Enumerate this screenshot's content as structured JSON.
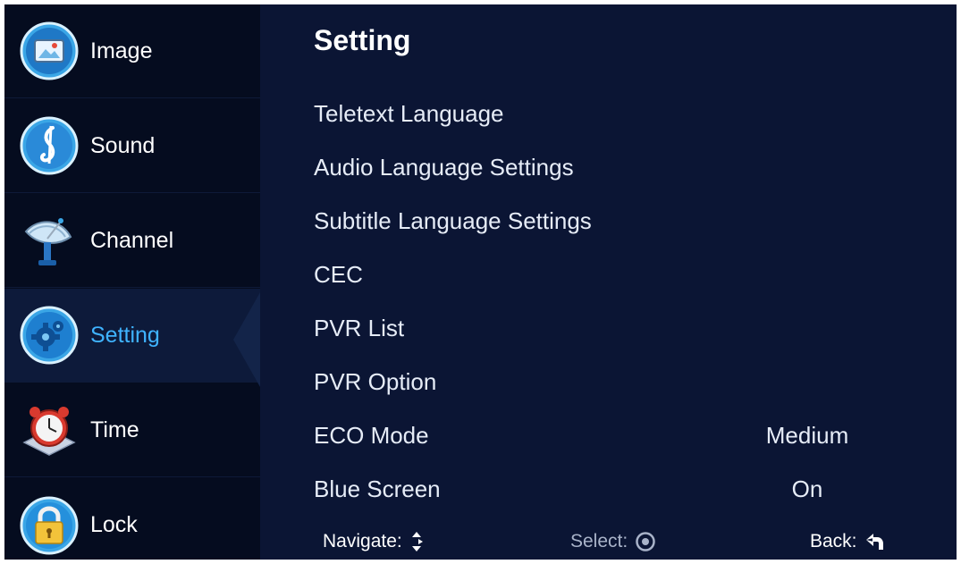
{
  "sidebar": {
    "items": [
      {
        "label": "Image",
        "icon": "image-icon"
      },
      {
        "label": "Sound",
        "icon": "music-note-icon"
      },
      {
        "label": "Channel",
        "icon": "satellite-dish-icon"
      },
      {
        "label": "Setting",
        "icon": "gear-icon",
        "active": true
      },
      {
        "label": "Time",
        "icon": "alarm-clock-icon"
      },
      {
        "label": "Lock",
        "icon": "padlock-icon"
      }
    ]
  },
  "main": {
    "title": "Setting",
    "menu": [
      {
        "label": "Teletext Language",
        "value": ""
      },
      {
        "label": "Audio Language Settings",
        "value": ""
      },
      {
        "label": "Subtitle Language Settings",
        "value": ""
      },
      {
        "label": "CEC",
        "value": ""
      },
      {
        "label": "PVR List",
        "value": ""
      },
      {
        "label": "PVR Option",
        "value": ""
      },
      {
        "label": "ECO Mode",
        "value": "Medium"
      },
      {
        "label": "Blue Screen",
        "value": "On"
      }
    ]
  },
  "footer": {
    "navigate": "Navigate:",
    "select": "Select:",
    "back": "Back:"
  },
  "colors": {
    "background": "#0b1534",
    "sidebar": "#050c1f",
    "active_text": "#3fb3ff",
    "text": "#e6ecf7"
  }
}
